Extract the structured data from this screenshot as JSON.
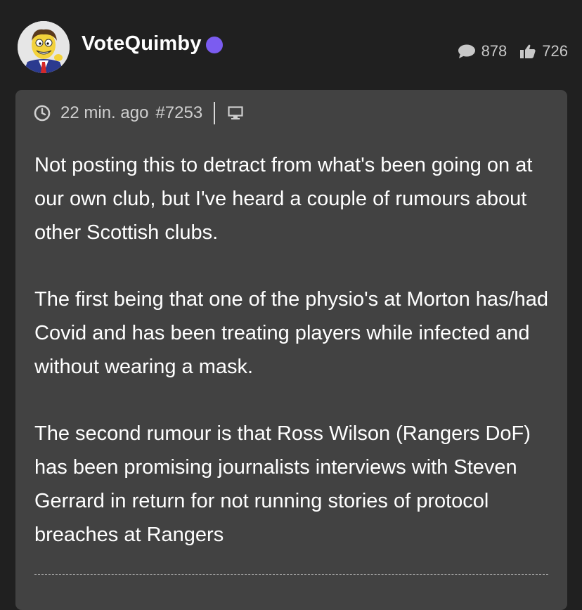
{
  "post": {
    "username": "VoteQuimby",
    "comment_count": "878",
    "like_count": "726",
    "timestamp": "22 min. ago",
    "post_number": "#7253",
    "paragraphs": [
      "Not posting this to detract from what's been going on at our own club, but I've heard a couple of rumours about other Scottish clubs.",
      "The first being that one of the physio's at Morton has/had Covid and has been treating players while infected and without wearing a mask.",
      "The second rumour is that Ross Wilson (Rangers DoF) has been promising journalists interviews with Steven Gerrard in return for not running stories of protocol breaches at Rangers"
    ]
  },
  "icons": {
    "avatar": "cartoon-avatar-icon",
    "online": "online-status-icon",
    "comments": "speech-bubble-icon",
    "likes": "thumbs-up-icon",
    "time": "clock-icon",
    "device": "desktop-monitor-icon"
  },
  "colors": {
    "background": "#202020",
    "card": "#424242",
    "online_dot": "#7b5cf0",
    "meta_text": "#cfcfcf"
  }
}
